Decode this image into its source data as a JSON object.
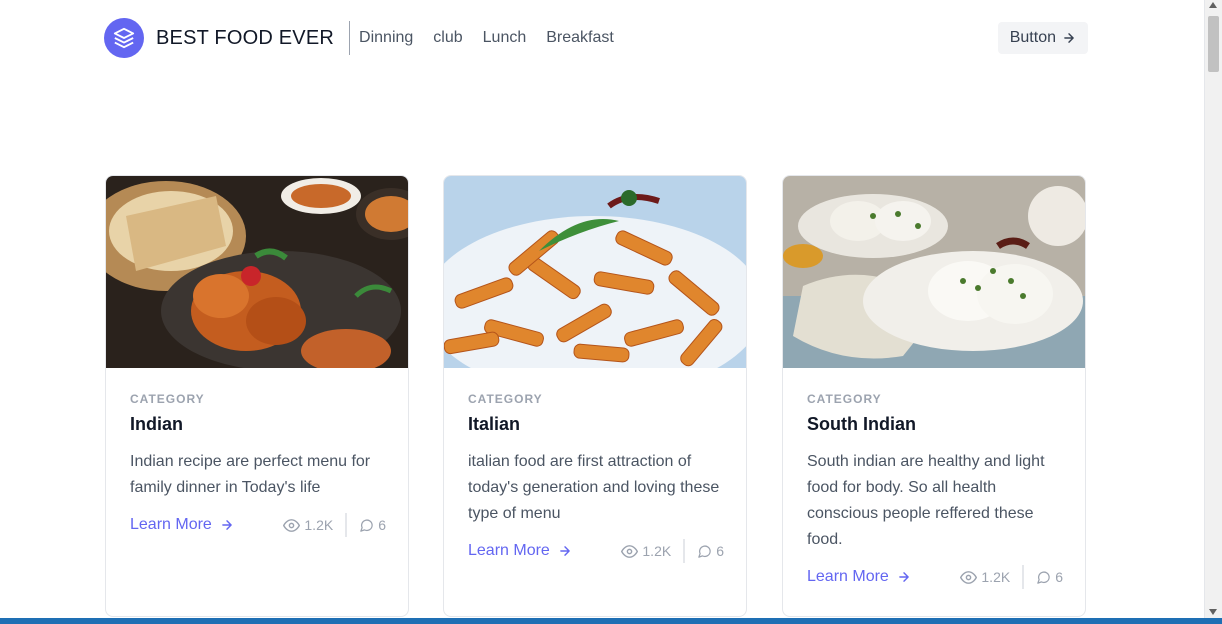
{
  "header": {
    "brand": "BEST FOOD EVER",
    "nav": [
      "Dinning",
      "club",
      "Lunch",
      "Breakfast"
    ],
    "button_label": "Button"
  },
  "cards": [
    {
      "category": "CATEGORY",
      "title": "Indian",
      "description": "Indian recipe are perfect menu for family dinner in Today's life",
      "learn_more": "Learn More",
      "views": "1.2K",
      "comments": "6"
    },
    {
      "category": "CATEGORY",
      "title": "Italian",
      "description": "italian food are first attraction of today's generation and loving these type of menu",
      "learn_more": "Learn More",
      "views": "1.2K",
      "comments": "6"
    },
    {
      "category": "CATEGORY",
      "title": "South Indian",
      "description": "South indian are healthy and light food for body. So all health conscious people reffered these food.",
      "learn_more": "Learn More",
      "views": "1.2K",
      "comments": "6"
    }
  ],
  "colors": {
    "accent": "#6366f1",
    "text": "#111827",
    "muted": "#9ca3af"
  },
  "icons": [
    "layers-logo-icon",
    "arrow-right-icon",
    "eye-icon",
    "comment-icon"
  ]
}
